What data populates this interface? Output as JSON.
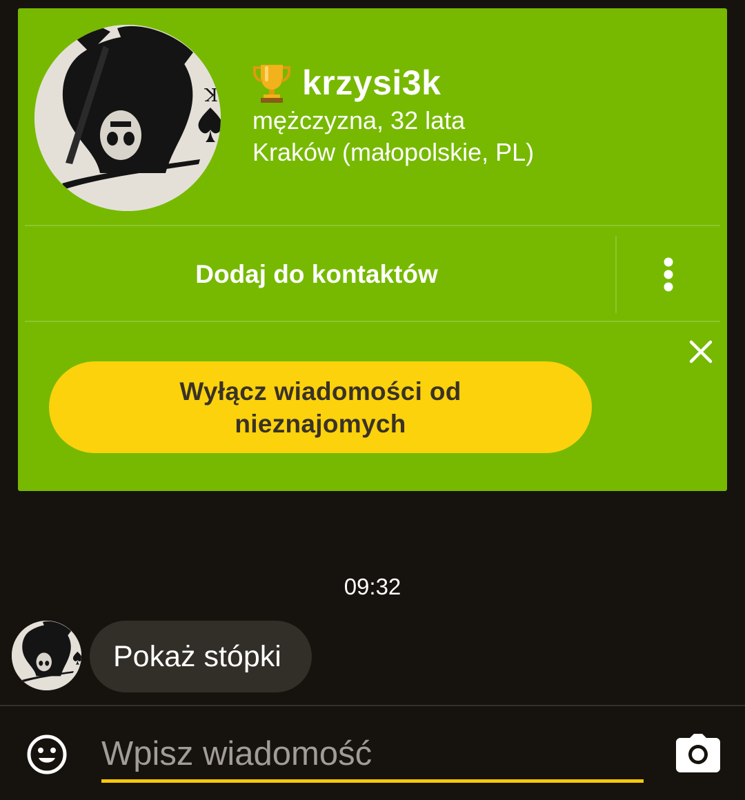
{
  "profile": {
    "username": "krzysi3k",
    "gender_age": "mężczyzna, 32 lata",
    "location": "Kraków (małopolskie, PL)",
    "trophy_icon": "trophy-icon",
    "avatar_card_letter": "K"
  },
  "actions": {
    "add_contact_label": "Dodaj do kontaktów",
    "more_icon": "more-vertical-icon",
    "close_icon": "close-icon",
    "disable_messages_label": "Wyłącz wiadomości od nieznajomych"
  },
  "chat": {
    "timestamp": "09:32",
    "messages": [
      {
        "text": "Pokaż stópki",
        "direction": "incoming"
      }
    ]
  },
  "input_bar": {
    "placeholder": "Wpisz wiadomość",
    "value": "",
    "emoji_icon": "emoji-icon",
    "camera_icon": "camera-icon"
  },
  "colors": {
    "background": "#16130e",
    "card_green": "#76b900",
    "accent_yellow": "#fbd20c",
    "bubble": "#322f29",
    "input_underline": "#fbc80c"
  }
}
